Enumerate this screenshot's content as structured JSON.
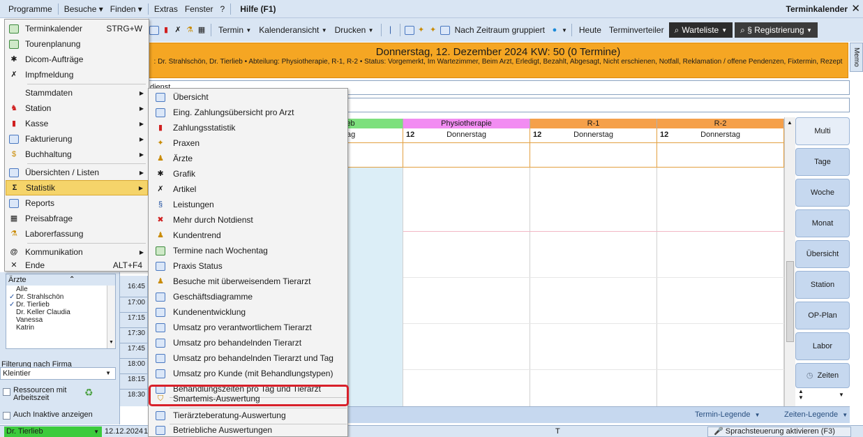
{
  "menubar": {
    "items": [
      "Programme",
      "Besuche ▾",
      "Finden ▾",
      "Extras",
      "Fenster",
      "?"
    ],
    "help": "Hilfe (F1)",
    "app_title": "Terminkalender",
    "close": "✕"
  },
  "toolbar": {
    "termin": "Termin",
    "kalenderansicht": "Kalenderansicht",
    "drucken": "Drucken",
    "nach_zeitraum": "Nach Zeitraum gruppiert",
    "heute": "Heute",
    "terminverteiler": "Terminverteiler",
    "warteliste": "Warteliste",
    "registrierung": "§ Registrierung"
  },
  "header": {
    "date_title": "Donnerstag, 12. Dezember 2024  KW: 50 (0 Termine)",
    "filter_text": ": Dr. Strahlschön, Dr. Tierlieb • Abteilung: Physiotherapie, R-1, R-2 • Status: Vorgemerkt, Im Wartezimmer, Beim Arzt, Erledigt, Bezahlt, Abgesagt, Nicht erschienen, Notfall, Reklamation / offene Pendenzen, Fixtermin, Rezept",
    "memo": "Memo",
    "row_notdienst": "dienst"
  },
  "grid": {
    "columns": [
      {
        "name": "ieb",
        "day_num": "",
        "day": "tag",
        "color": "#7de07d"
      },
      {
        "name": "Physiotherapie",
        "day_num": "12",
        "day": "Donnerstag",
        "color": "#f28cf2"
      },
      {
        "name": "R-1",
        "day_num": "12",
        "day": "Donnerstag",
        "color": "#f5a04a"
      },
      {
        "name": "R-2",
        "day_num": "12",
        "day": "Donnerstag",
        "color": "#f5a04a"
      }
    ]
  },
  "view_buttons": [
    "Multi",
    "Tage",
    "Woche",
    "Monat",
    "Übersicht",
    "Station",
    "OP-Plan",
    "Labor",
    "Zeiten"
  ],
  "times": [
    "16:45",
    "17:00",
    "17:15",
    "17:30",
    "17:45",
    "18:00",
    "18:15",
    "18:30"
  ],
  "left_panel": {
    "aerzte_title": "Ärzte",
    "aerzte": [
      {
        "label": "Alle",
        "checked": false
      },
      {
        "label": "Dr. Strahlschön",
        "checked": true
      },
      {
        "label": "Dr. Tierlieb",
        "checked": true
      },
      {
        "label": "Dr. Keller Claudia",
        "checked": false
      },
      {
        "label": "Vanessa",
        "checked": false
      },
      {
        "label": "Katrin",
        "checked": false
      }
    ],
    "filter_firma_label": "Filterung nach Firma",
    "firma_value": "Kleintier",
    "ressourcen": "Ressourcen mit Arbeitszeit",
    "inaktive": "Auch Inaktive anzeigen"
  },
  "legend": {
    "termin_legende": "Termin-Legende",
    "zeiten_legende": "Zeiten-Legende"
  },
  "statusbar": {
    "user": "Dr. Tierlieb",
    "date": "12.12.2024",
    "date_suffix": "1",
    "mid": "T",
    "voice": "Sprachsteuerung aktivieren (F3)"
  },
  "main_menu": [
    {
      "label": "Terminkalender",
      "shortcut": "STRG+W",
      "icon": "calendar-icon",
      "arrow": false
    },
    {
      "label": "Tourenplanung",
      "shortcut": "",
      "icon": "calendar-icon",
      "arrow": false
    },
    {
      "label": "Dicom-Aufträge",
      "shortcut": "",
      "icon": "dicom-icon",
      "arrow": false
    },
    {
      "label": "Impfmeldung",
      "shortcut": "",
      "icon": "syringe-icon",
      "arrow": false
    },
    {
      "label": "Stammdaten",
      "shortcut": "",
      "icon": "",
      "arrow": true
    },
    {
      "label": "Station",
      "shortcut": "",
      "icon": "station-icon",
      "arrow": true
    },
    {
      "label": "Kasse",
      "shortcut": "",
      "icon": "cash-icon",
      "arrow": true
    },
    {
      "label": "Fakturierung",
      "shortcut": "",
      "icon": "invoice-icon",
      "arrow": true
    },
    {
      "label": "Buchhaltung",
      "shortcut": "",
      "icon": "accounting-icon",
      "arrow": true
    },
    {
      "label": "Übersichten / Listen",
      "shortcut": "",
      "icon": "list-icon",
      "arrow": true
    },
    {
      "label": "Statistik",
      "shortcut": "",
      "icon": "sigma-icon",
      "arrow": true
    },
    {
      "label": "Reports",
      "shortcut": "",
      "icon": "report-icon",
      "arrow": false
    },
    {
      "label": "Preisabfrage",
      "shortcut": "",
      "icon": "calculator-icon",
      "arrow": false
    },
    {
      "label": "Laborerfassung",
      "shortcut": "",
      "icon": "lab-icon",
      "arrow": false
    },
    {
      "label": "Kommunikation",
      "shortcut": "",
      "icon": "at-icon",
      "arrow": true
    },
    {
      "label": "Ende",
      "shortcut": "ALT+F4",
      "icon": "close-icon",
      "arrow": false
    }
  ],
  "sub_menu": [
    "Übersicht",
    "Eing. Zahlungsübersicht pro Arzt",
    "Zahlungsstatistik",
    "Praxen",
    "Ärzte",
    "Grafik",
    "Artikel",
    "Leistungen",
    "Mehr durch Notdienst",
    "Kundentrend",
    "Termine nach Wochentag",
    "Praxis Status",
    "Besuche mit überweisendem Tierarzt",
    "Geschäftsdiagramme",
    "Kundenentwicklung",
    "Umsatz pro verantwortlichem Tierarzt",
    "Umsatz pro behandelnden Tierarzt",
    "Umsatz pro behandelnden Tierarzt und Tag",
    "Umsatz pro Kunde (mit Behandlungstypen)",
    "Behandlungszeiten pro Tag und Tierarzt",
    "Smartemis-Auswertung",
    "Tierärzteberatung-Auswertung",
    "Betriebliche Auswertungen"
  ]
}
